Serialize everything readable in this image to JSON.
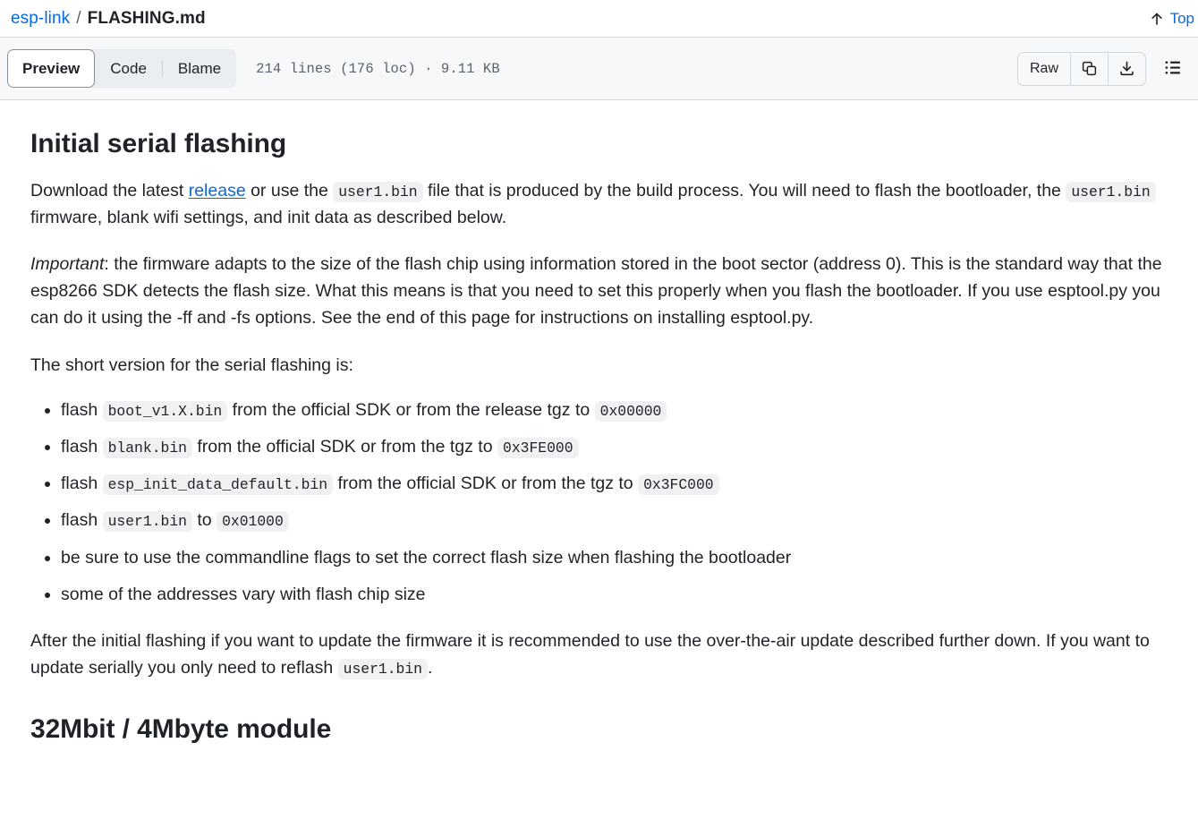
{
  "header": {
    "repo": "esp-link",
    "separator": "/",
    "file_name": "FLASHING.md",
    "top_label": "Top",
    "top_icon": "arrow-up-icon"
  },
  "toolbar": {
    "tabs": [
      {
        "label": "Preview",
        "active": true
      },
      {
        "label": "Code",
        "active": false
      },
      {
        "label": "Blame",
        "active": false
      }
    ],
    "file_meta": "214 lines (176 loc) · 9.11 KB",
    "raw_label": "Raw",
    "copy_icon": "copy-icon",
    "download_icon": "download-icon",
    "outline_icon": "outline-list-icon"
  },
  "content": {
    "heading1": "Initial serial flashing",
    "p1": {
      "part1": "Download the latest ",
      "link": "release",
      "part2": " or use the ",
      "code1": "user1.bin",
      "part3": " file that is produced by the build process. You will need to flash the bootloader, the ",
      "code2": "user1.bin",
      "part4": " firmware, blank wifi settings, and init data as described below."
    },
    "p2": {
      "emphasis": "Important",
      "text": ": the firmware adapts to the size of the flash chip using information stored in the boot sector (address 0). This is the standard way that the esp8266 SDK detects the flash size. What this means is that you need to set this properly when you flash the bootloader. If you use esptool.py you can do it using the -ff and -fs options. See the end of this page for instructions on installing esptool.py."
    },
    "p3": "The short version for the serial flashing is:",
    "list": [
      {
        "pre": "flash ",
        "code1": "boot_v1.X.bin",
        "mid": " from the official SDK or from the release tgz to ",
        "code2": "0x00000",
        "post": ""
      },
      {
        "pre": "flash ",
        "code1": "blank.bin",
        "mid": " from the official SDK or from the tgz to ",
        "code2": "0x3FE000",
        "post": ""
      },
      {
        "pre": "flash ",
        "code1": "esp_init_data_default.bin",
        "mid": " from the official SDK or from the tgz to ",
        "code2": "0x3FC000",
        "post": ""
      },
      {
        "pre": "flash ",
        "code1": "user1.bin",
        "mid": " to ",
        "code2": "0x01000",
        "post": ""
      },
      {
        "pre": "be sure to use the commandline flags to set the correct flash size when flashing the bootloader",
        "code1": "",
        "mid": "",
        "code2": "",
        "post": ""
      },
      {
        "pre": "some of the addresses vary with flash chip size",
        "code1": "",
        "mid": "",
        "code2": "",
        "post": ""
      }
    ],
    "p4": {
      "part1": "After the initial flashing if you want to update the firmware it is recommended to use the over-the-air update described further down. If you want to update serially you only need to reflash ",
      "code1": "user1.bin",
      "part2": "."
    },
    "heading2": "32Mbit / 4Mbyte module"
  },
  "colors": {
    "link": "#0969da",
    "text": "#1f2328",
    "muted": "#59636e",
    "toolbar_bg": "#f6f8fa",
    "segment_bg": "#eaeef2",
    "code_bg": "#eff1f3",
    "border": "#d1d9e0"
  }
}
